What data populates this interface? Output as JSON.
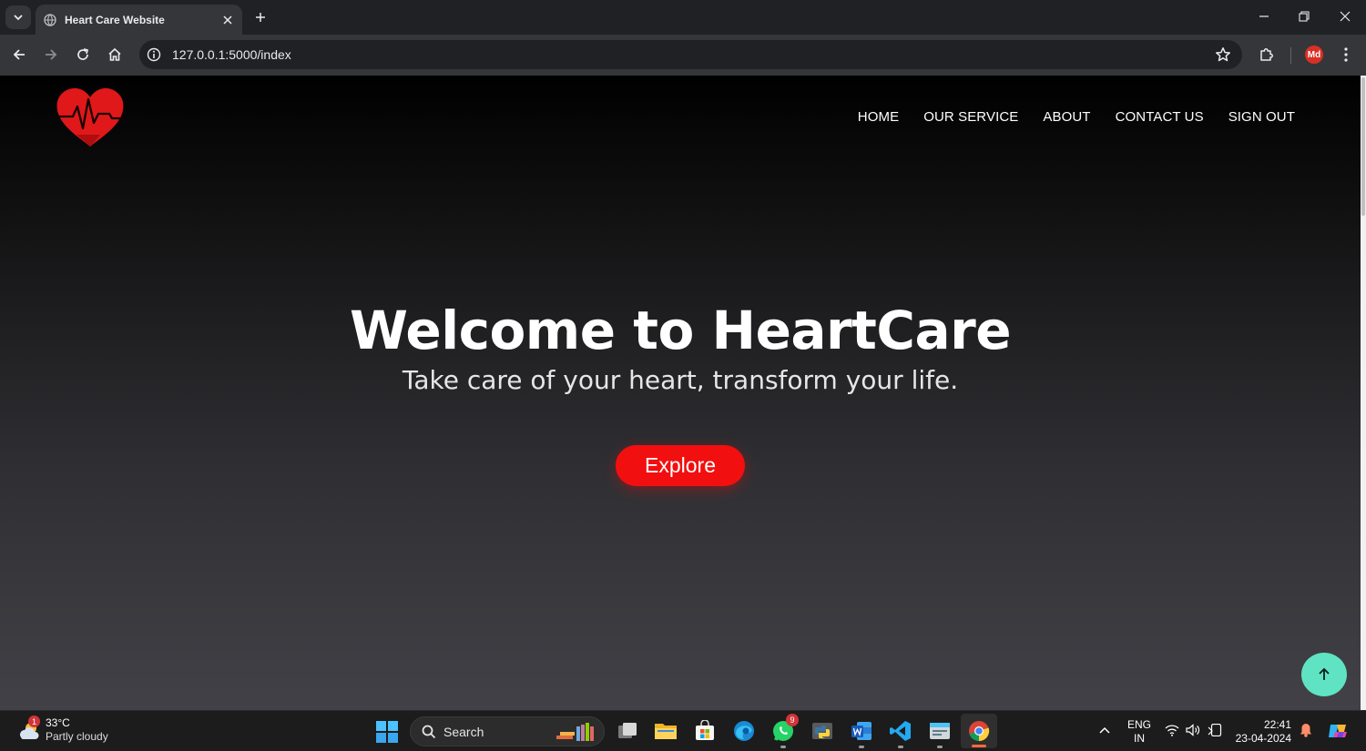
{
  "browser": {
    "tab_title": "Heart Care Website",
    "url": "127.0.0.1:5000/index",
    "profile_initials": "Md"
  },
  "site": {
    "nav": [
      "HOME",
      "OUR SERVICE",
      "ABOUT",
      "CONTACT US",
      "SIGN OUT"
    ],
    "hero_title": "Welcome to HeartCare",
    "hero_subtitle": "Take care of your heart, transform your life.",
    "cta_label": "Explore",
    "colors": {
      "accent": "#f20f10",
      "to_top": "#5fe3c3"
    }
  },
  "taskbar": {
    "weather_temp": "33°C",
    "weather_condition": "Partly cloudy",
    "weather_badge": "1",
    "search_label": "Search",
    "whatsapp_badge": "9",
    "lang_line1": "ENG",
    "lang_line2": "IN",
    "time": "22:41",
    "date": "23-04-2024",
    "apps": [
      "task-view",
      "file-explorer",
      "microsoft-store",
      "edge",
      "whatsapp",
      "python",
      "word",
      "vscode",
      "terminal",
      "chrome"
    ]
  }
}
